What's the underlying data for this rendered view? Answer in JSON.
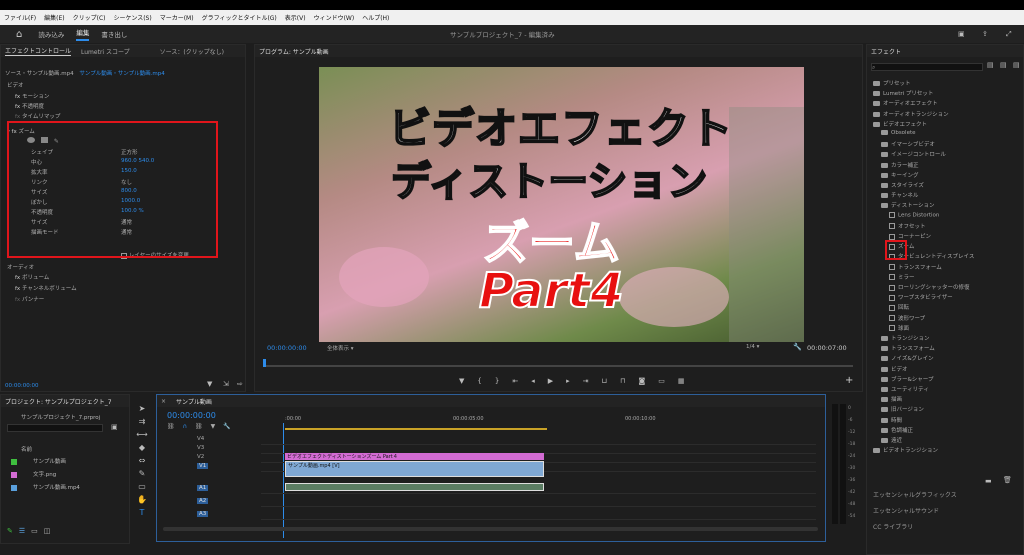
{
  "menu": [
    "ファイル(F)",
    "編集(E)",
    "クリップ(C)",
    "シーケンス(S)",
    "マーカー(M)",
    "グラフィックとタイトル(G)",
    "表示(V)",
    "ウィンドウ(W)",
    "ヘルプ(H)"
  ],
  "header": {
    "home": "⌂",
    "tabs": [
      "読み込み",
      "編集",
      "書き出し"
    ],
    "title": "サンプルプロジェクト_7 - 編集済み"
  },
  "effect_controls": {
    "tabs": [
      "エフェクトコントロール",
      "Lumetri スコープ",
      "ソース：(クリップなし)"
    ],
    "source": "ソース・サンプル動画.mp4",
    "sequence": "サンプル動画・サンプル動画.mp4",
    "video_label": "ビデオ",
    "motion": "モーション",
    "opacity": "不透明度",
    "time_remap": "タイムリマップ",
    "zoom": "ズーム",
    "params": [
      {
        "name": "シェイプ",
        "value": "正方形"
      },
      {
        "name": "中心",
        "value": "960.0    540.0"
      },
      {
        "name": "拡大率",
        "value": "150.0"
      },
      {
        "name": "リンク",
        "value": "なし"
      },
      {
        "name": "サイズ",
        "value": "800.0"
      },
      {
        "name": "ぼかし",
        "value": "1000.0"
      },
      {
        "name": "不透明度",
        "value": "100.0 %"
      },
      {
        "name": "サイズ",
        "value": "通常"
      },
      {
        "name": "描画モード",
        "value": "通常"
      }
    ],
    "layer_size": "レイヤーのサイズを変更",
    "audio_label": "オーディオ",
    "volume": "ボリューム",
    "channel_volume": "チャンネルボリューム",
    "panner": "パンナー",
    "timecode": "00:00:00:00"
  },
  "program": {
    "tab": "プログラム: サンプル動画",
    "overlay_line1": "ビデオエフェクト",
    "overlay_line2": "ディストーション",
    "overlay_line3": "ズーム",
    "overlay_line4": "Part4",
    "timecode": "00:00:00:00",
    "fit": "全体表示",
    "quality": "1/4",
    "duration": "00:00:07:00"
  },
  "effects": {
    "title": "エフェクト",
    "items": [
      {
        "label": "プリセット",
        "level": 0
      },
      {
        "label": "Lumetri プリセット",
        "level": 0
      },
      {
        "label": "オーディオエフェクト",
        "level": 0
      },
      {
        "label": "オーディオトランジション",
        "level": 0
      },
      {
        "label": "ビデオエフェクト",
        "level": 0
      },
      {
        "label": "Obsolete",
        "level": 1
      },
      {
        "label": "イマーシブビデオ",
        "level": 1
      },
      {
        "label": "イメージコントロール",
        "level": 1
      },
      {
        "label": "カラー補正",
        "level": 1
      },
      {
        "label": "キーイング",
        "level": 1
      },
      {
        "label": "スタイライズ",
        "level": 1
      },
      {
        "label": "チャンネル",
        "level": 1
      },
      {
        "label": "ディストーション",
        "level": 1
      },
      {
        "label": "Lens Distortion",
        "level": 2
      },
      {
        "label": "オフセット",
        "level": 2
      },
      {
        "label": "コーナーピン",
        "level": 2
      },
      {
        "label": "ズーム",
        "level": 2
      },
      {
        "label": "タービュレントディスプレイス",
        "level": 2
      },
      {
        "label": "トランスフォーム",
        "level": 2
      },
      {
        "label": "ミラー",
        "level": 2
      },
      {
        "label": "ローリングシャッターの修復",
        "level": 2
      },
      {
        "label": "ワープスタビライザー",
        "level": 2
      },
      {
        "label": "回転",
        "level": 2
      },
      {
        "label": "波形ワープ",
        "level": 2
      },
      {
        "label": "球面",
        "level": 2
      },
      {
        "label": "トランジション",
        "level": 1
      },
      {
        "label": "トランスフォーム",
        "level": 1
      },
      {
        "label": "ノイズ&グレイン",
        "level": 1
      },
      {
        "label": "ビデオ",
        "level": 1
      },
      {
        "label": "ブラー&シャープ",
        "level": 1
      },
      {
        "label": "ユーティリティ",
        "level": 1
      },
      {
        "label": "描画",
        "level": 1
      },
      {
        "label": "旧バージョン",
        "level": 1
      },
      {
        "label": "時間",
        "level": 1
      },
      {
        "label": "色調補正",
        "level": 1
      },
      {
        "label": "遠近",
        "level": 1
      },
      {
        "label": "ビデオトランジション",
        "level": 0
      }
    ],
    "bottom": [
      "エッセンシャルグラフィックス",
      "エッセンシャルサウンド",
      "CC ライブラリ"
    ]
  },
  "project": {
    "tab": "プロジェクト: サンプルプロジェクト_7",
    "file": "サンプルプロジェクト_7.prproj",
    "col": "名前",
    "items": [
      {
        "name": "サンプル動画",
        "color": "#3fbf3f"
      },
      {
        "name": "文字.png",
        "color": "#d36bd3"
      },
      {
        "name": "サンプル動画.mp4",
        "color": "#5aa0dc"
      }
    ]
  },
  "timeline": {
    "tab": "サンプル動画",
    "timecode": "00:00:00:00",
    "ruler": [
      ":00:00",
      "00:00:05:00",
      "00:00:10:00"
    ],
    "tracks": [
      "V4",
      "V3",
      "V2",
      "V1",
      "A1",
      "A2",
      "A3"
    ],
    "clip_title": "ビデオエフェクトディストーションズーム Part４",
    "clip_video": "サンプル動画.mp4 [V]",
    "meter": [
      "0",
      "-6",
      "-12",
      "-18",
      "-24",
      "-30",
      "-36",
      "-42",
      "-48",
      "-54"
    ]
  }
}
